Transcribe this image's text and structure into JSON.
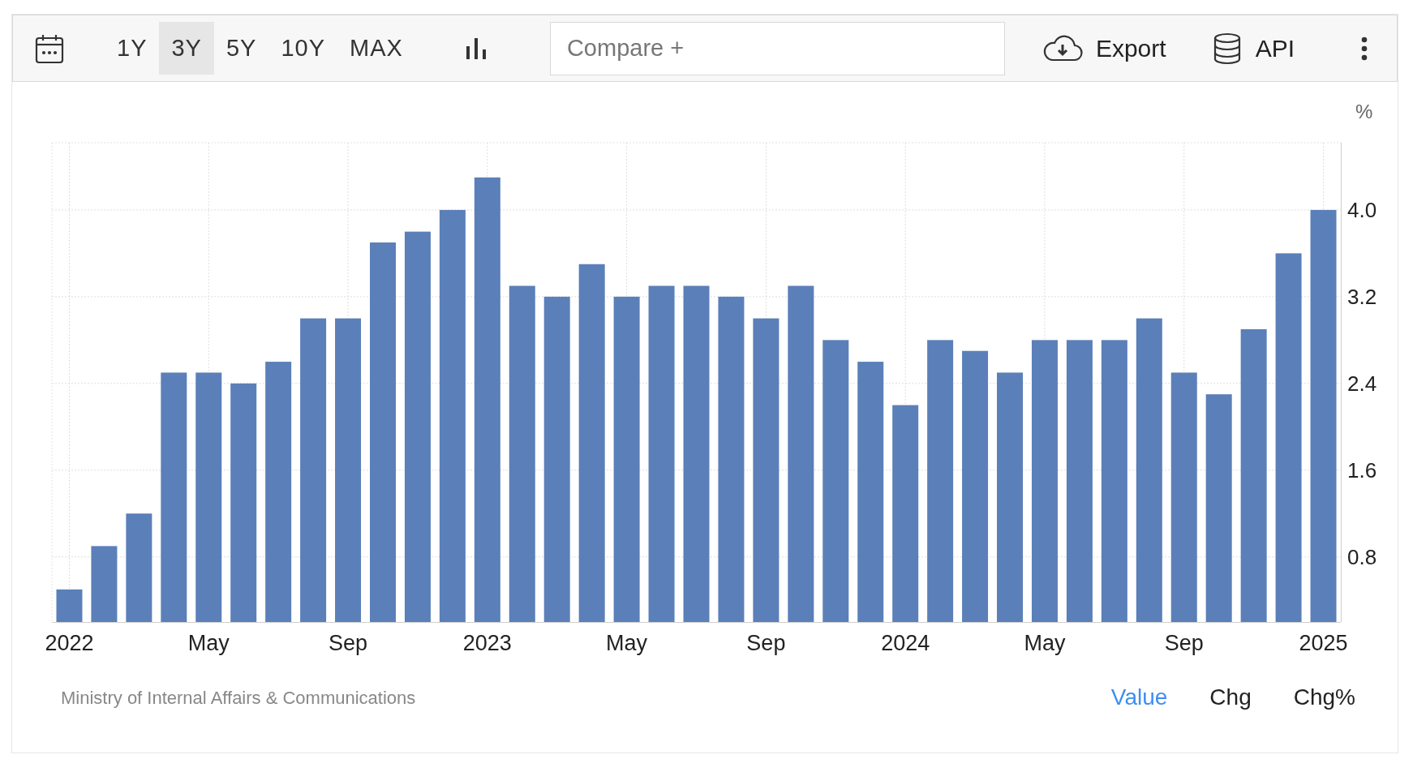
{
  "toolbar": {
    "ranges": [
      {
        "label": "1Y",
        "selected": false
      },
      {
        "label": "3Y",
        "selected": true
      },
      {
        "label": "5Y",
        "selected": false
      },
      {
        "label": "10Y",
        "selected": false
      },
      {
        "label": "MAX",
        "selected": false
      }
    ],
    "compare": {
      "placeholder": "Compare +"
    },
    "export": {
      "label": "Export"
    },
    "api": {
      "label": "API"
    }
  },
  "chart": {
    "unit": "%",
    "chart_data": {
      "type": "bar",
      "categories": [
        "2022",
        null,
        null,
        null,
        "May",
        null,
        null,
        null,
        "Sep",
        null,
        null,
        null,
        "2023",
        null,
        null,
        null,
        "May",
        null,
        null,
        null,
        "Sep",
        null,
        null,
        null,
        "2024",
        null,
        null,
        null,
        "May",
        null,
        null,
        null,
        "Sep",
        null,
        null,
        null,
        "2025"
      ],
      "grid": true,
      "series": [
        {
          "color": "#5b7fb9",
          "values": [
            0.5,
            0.9,
            1.2,
            2.5,
            2.5,
            2.4,
            2.6,
            3.0,
            3.0,
            3.7,
            3.8,
            4.0,
            4.3,
            3.3,
            3.2,
            3.5,
            3.2,
            3.3,
            3.3,
            3.2,
            3.0,
            3.3,
            2.8,
            2.6,
            2.2,
            2.8,
            2.7,
            2.5,
            2.8,
            2.8,
            2.8,
            3.0,
            2.5,
            2.3,
            2.9,
            3.6,
            4.0
          ]
        }
      ],
      "ylim": [
        0.2,
        4.62
      ],
      "yticks": [
        {
          "value": 0.8,
          "label": "0.8"
        },
        {
          "value": 1.6,
          "label": "1.6"
        },
        {
          "value": 2.4,
          "label": "2.4"
        },
        {
          "value": 3.2,
          "label": "3.2"
        },
        {
          "value": 4.0,
          "label": "4.0"
        }
      ]
    }
  },
  "footer": {
    "source": "Ministry of Internal Affairs & Communications",
    "views": [
      {
        "label": "Value",
        "selected": true
      },
      {
        "label": "Chg",
        "selected": false
      },
      {
        "label": "Chg%",
        "selected": false
      }
    ]
  }
}
